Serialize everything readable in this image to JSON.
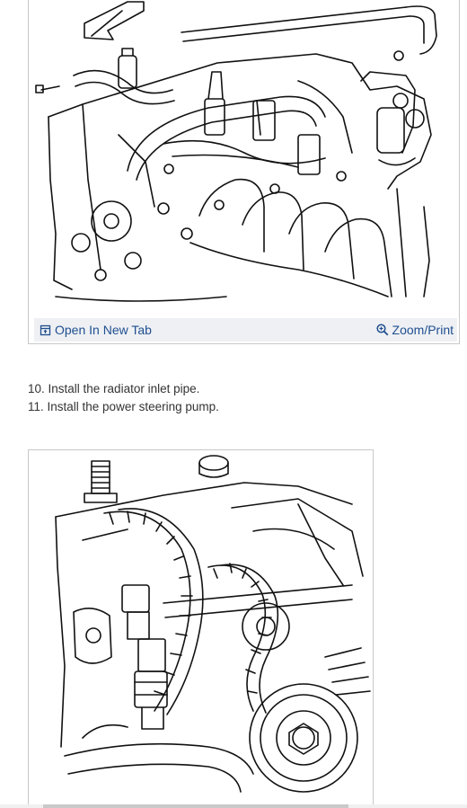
{
  "figure1": {
    "open_tab_label": "Open In New Tab",
    "zoom_print_label": "Zoom/Print",
    "open_tab_icon": "open-in-new-tab-icon",
    "zoom_icon": "zoom-icon"
  },
  "steps": [
    "10. Install the radiator inlet pipe.",
    "11. Install the power steering pump."
  ],
  "colors": {
    "link": "#1f4f8f",
    "toolbar_bg": "#eef0f4",
    "text": "#333333",
    "border": "#c8c8c8"
  }
}
